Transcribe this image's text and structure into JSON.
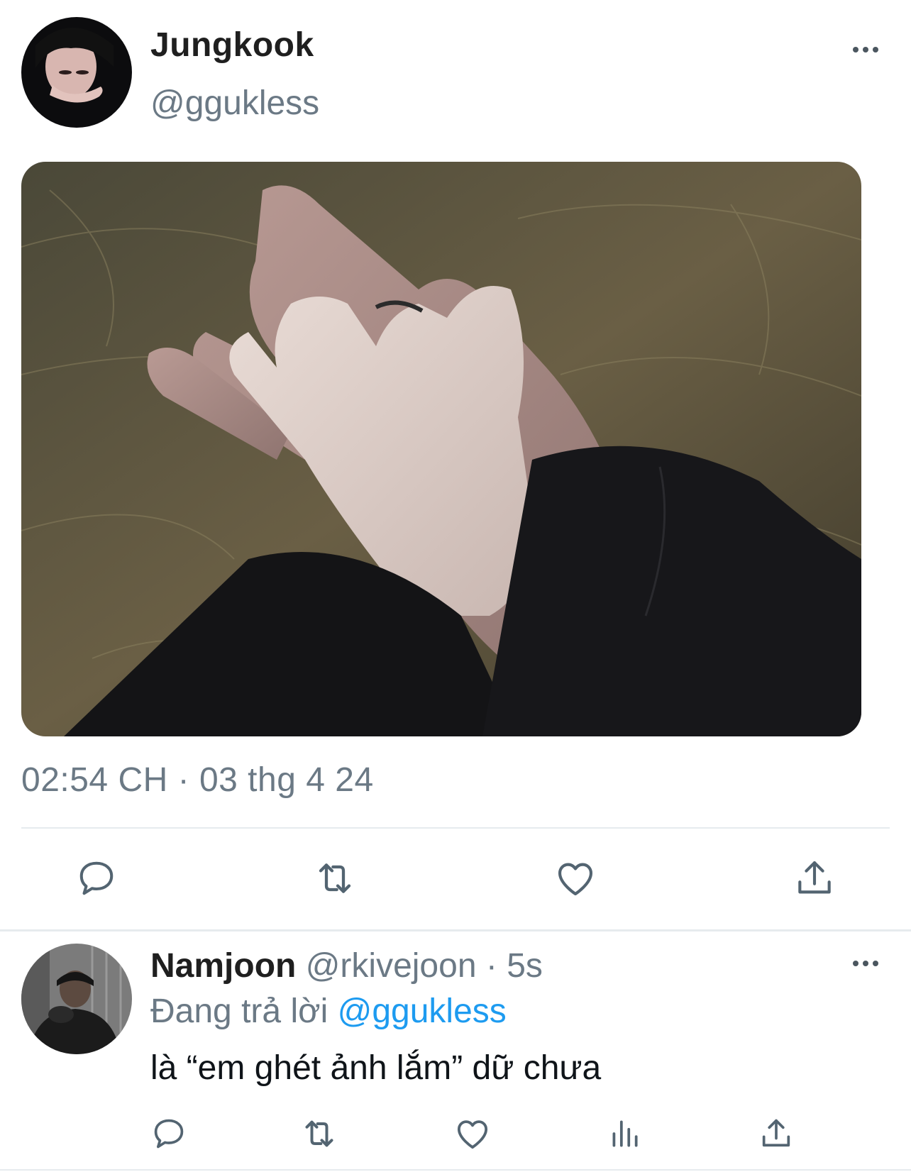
{
  "tweet": {
    "display_name": "Jungkook",
    "handle": "@ggukless",
    "timestamp": "02:54 CH · 03 thg 4 24",
    "media_icon": "photo-of-holding-hands-in-grass",
    "actions": {
      "reply_icon": "reply-icon",
      "retweet_icon": "retweet-icon",
      "like_icon": "heart-icon",
      "share_icon": "share-icon"
    }
  },
  "reply": {
    "display_name": "Namjoon",
    "handle": "@rkivejoon",
    "separator": "·",
    "time": "5s",
    "context_prefix": "Đang trả lời",
    "context_mention": "@ggukless",
    "text": "là “em ghét ảnh lắm” dữ chưa"
  },
  "colors": {
    "muted": "#6b7985",
    "link": "#1d9bf0",
    "divider": "#e6ebee"
  }
}
